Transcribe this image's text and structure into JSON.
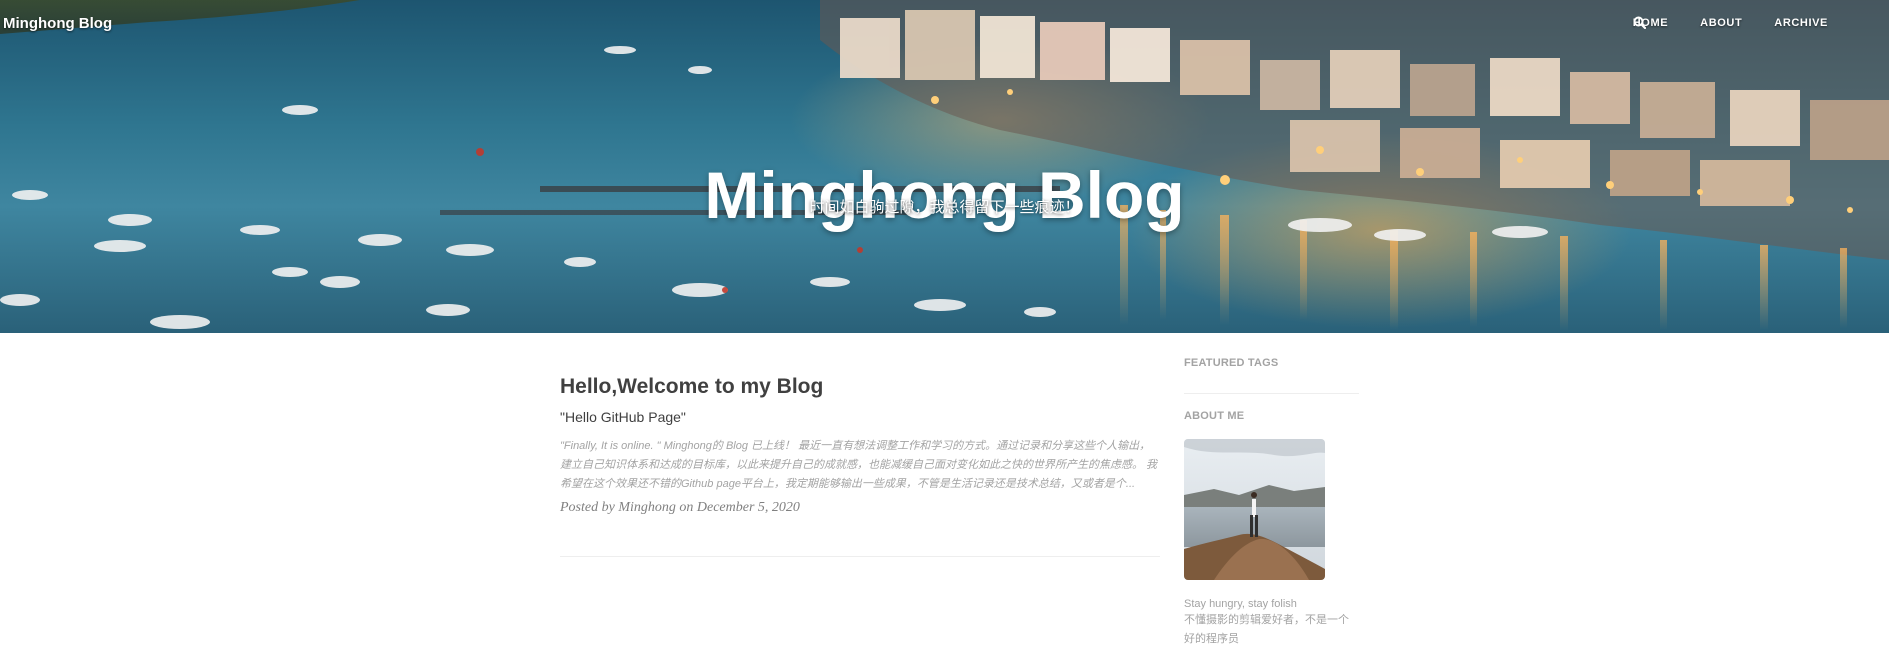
{
  "nav": {
    "brand": "Minghong Blog",
    "items": [
      "HOME",
      "ABOUT",
      "ARCHIVE"
    ]
  },
  "hero": {
    "title": "Minghong Blog",
    "subtitle": "时间如白驹过隙，我总得留下一些痕迹！"
  },
  "posts": [
    {
      "title": "Hello,Welcome to my Blog",
      "subtitle": "\"Hello GitHub Page\"",
      "excerpt": "\"Finally, It is online. \" Minghong的 Blog 已上线！ 最近一直有想法调整工作和学习的方式。通过记录和分享这些个人输出，建立自己知识体系和达成的目标库，以此来提升自己的成就感，也能减缓自己面对变化如此之快的世界所产生的焦虑感。 我希望在这个效果还不错的Github page平台上，我定期能够输出一些成果，不管是生活记录还是技术总结，又或者是个...",
      "meta": "Posted by Minghong on December 5, 2020"
    }
  ],
  "sidebar": {
    "featured_tags_heading": "FEATURED TAGS",
    "about_heading": "ABOUT ME",
    "motto": "Stay hungry, stay folish",
    "bio": "不懂摄影的剪辑爱好者，不是一个好的程序员"
  },
  "icons": {
    "search": "search-icon"
  },
  "colors": {
    "text_dark": "#404040",
    "text_muted": "#a3a3a3",
    "meta": "#808080",
    "divider": "#eeeeee"
  }
}
